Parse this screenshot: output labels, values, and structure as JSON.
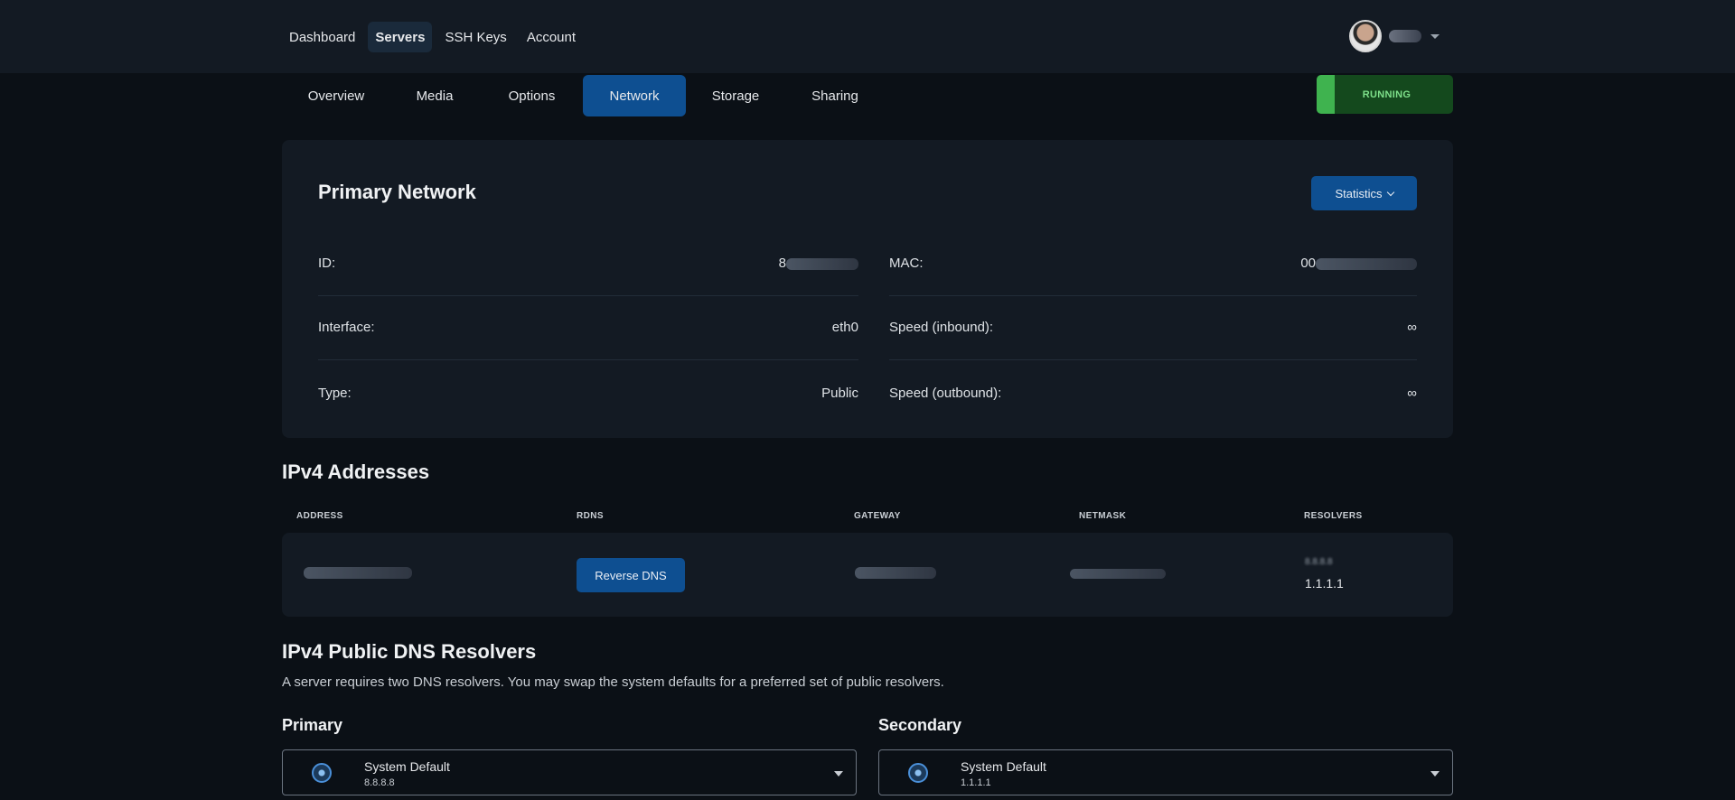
{
  "topnav": {
    "items": [
      {
        "label": "Dashboard"
      },
      {
        "label": "Servers"
      },
      {
        "label": "SSH Keys"
      },
      {
        "label": "Account"
      }
    ],
    "user_name": "e"
  },
  "tabs": [
    "Overview",
    "Media",
    "Options",
    "Network",
    "Storage",
    "Sharing"
  ],
  "active_tab": "Network",
  "status": "RUNNING",
  "primary_network": {
    "title": "Primary Network",
    "statistics_label": "Statistics",
    "fields": {
      "id": {
        "label": "ID:",
        "value": "8"
      },
      "mac": {
        "label": "MAC:",
        "value": "00"
      },
      "interface": {
        "label": "Interface:",
        "value": "eth0"
      },
      "speed_in": {
        "label": "Speed (inbound):",
        "value": "∞"
      },
      "type": {
        "label": "Type:",
        "value": "Public"
      },
      "speed_out": {
        "label": "Speed (outbound):",
        "value": "∞"
      }
    }
  },
  "ipv4": {
    "title": "IPv4 Addresses",
    "columns": [
      "ADDRESS",
      "RDNS",
      "GATEWAY",
      "NETMASK",
      "RESOLVERS"
    ],
    "rdns_button": "Reverse DNS",
    "resolvers": [
      "8.8.8.8",
      "1.1.1.1"
    ]
  },
  "dns": {
    "title": "IPv4 Public DNS Resolvers",
    "description": "A server requires two DNS resolvers. You may swap the system defaults for a preferred set of public resolvers.",
    "primary": {
      "label": "Primary",
      "selected": "System Default",
      "value": "8.8.8.8"
    },
    "secondary": {
      "label": "Secondary",
      "selected": "System Default",
      "value": "1.1.1.1"
    }
  },
  "colors": {
    "background": "#0b1016",
    "panel": "#131a23",
    "accent": "#0e4f91",
    "running": "#14491d"
  }
}
